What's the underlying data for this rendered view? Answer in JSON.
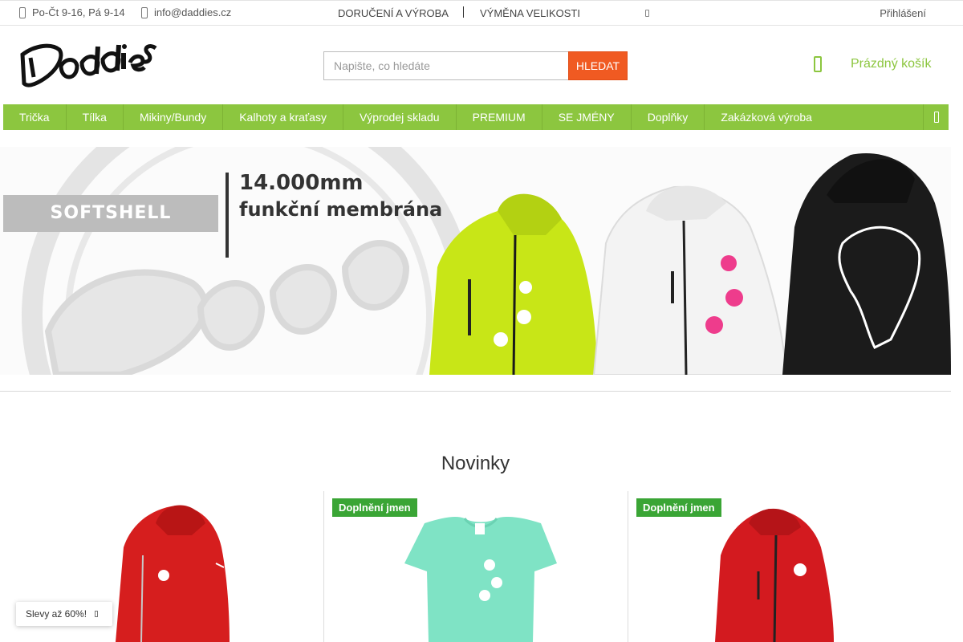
{
  "topbar": {
    "hours": "Po-Čt 9-16, Pá 9-14",
    "email": "info@daddies.cz",
    "links": [
      "DORUČENÍ A VÝROBA",
      "VÝMĚNA VELIKOSTI"
    ],
    "login": "Přihlášení"
  },
  "header": {
    "logo_text": "Daddies",
    "search_placeholder": "Napište, co hledáte",
    "search_button": "HLEDAT",
    "cart_label": "Prázdný košík"
  },
  "menu": {
    "items": [
      "Trička",
      "Tílka",
      "Mikiny/Bundy",
      "Kalhoty a kraťasy",
      "Výprodej skladu",
      "PREMIUM",
      "SE JMÉNY",
      "Doplňky",
      "Zakázková výroba"
    ]
  },
  "banner": {
    "label": "SOFTSHELL",
    "line1": "14.000mm",
    "line2": "funkční membrána"
  },
  "section": {
    "title": "Novinky"
  },
  "products": [
    {
      "badge": ""
    },
    {
      "badge": "Doplnění jmen"
    },
    {
      "badge": "Doplnění jmen"
    }
  ],
  "promo": {
    "label": "Slevy až 60%!"
  },
  "colors": {
    "accent_green": "#8cc63f",
    "search_orange": "#f05a22",
    "badge_green": "#3aa535"
  }
}
